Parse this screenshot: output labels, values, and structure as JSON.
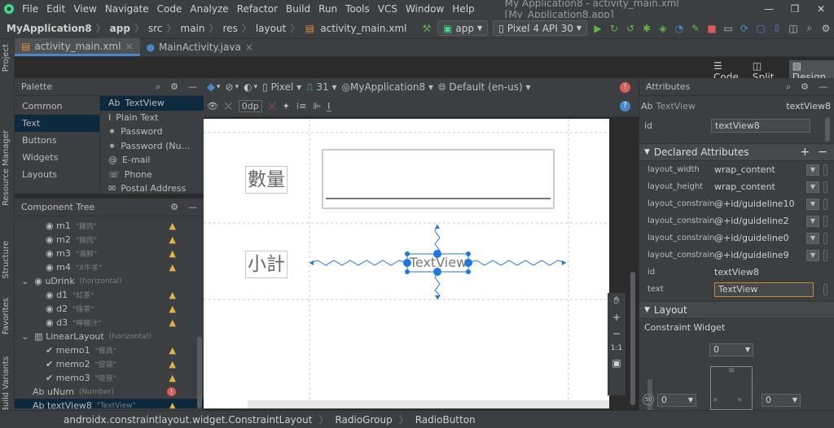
{
  "window": {
    "title": "My Application8 - activity_main.xml [My_Application8.app]"
  },
  "menu": [
    "File",
    "Edit",
    "View",
    "Navigate",
    "Code",
    "Analyze",
    "Refactor",
    "Build",
    "Run",
    "Tools",
    "VCS",
    "Window",
    "Help"
  ],
  "breadcrumb": [
    "MyApplication8",
    "app",
    "src",
    "main",
    "res",
    "layout",
    "activity_main.xml"
  ],
  "run": {
    "config": "app",
    "device": "Pixel 4 API 30"
  },
  "tabs": [
    "activity_main.xml",
    "MainActivity.java"
  ],
  "views": {
    "code": "Code",
    "split": "Split",
    "design": "Design"
  },
  "side_labels": {
    "project": "Project",
    "resource_manager": "Resource Manager",
    "structure": "Structure",
    "favorites": "Favorites",
    "build_variants": "Build Variants"
  },
  "palette": {
    "title": "Palette",
    "categories": [
      "Common",
      "Text",
      "Buttons",
      "Widgets",
      "Layouts"
    ],
    "items": [
      "TextView",
      "Plain Text",
      "Password",
      "Password (Nu...",
      "E-mail",
      "Phone",
      "Postal Address"
    ],
    "item_icon": "Ab"
  },
  "design_toolbar": {
    "device": "Pixel",
    "api": "31",
    "theme": "MyApplication8",
    "locale": "Default (en-us)",
    "margin": "0dp"
  },
  "tree": {
    "title": "Component Tree",
    "rows": [
      {
        "name": "m1",
        "hint": "\"雞肉\""
      },
      {
        "name": "m2",
        "hint": "\"豬肉\""
      },
      {
        "name": "m3",
        "hint": "\"海鮮\""
      },
      {
        "name": "m4",
        "hint": "\"X牛羊\""
      },
      {
        "name": "uDrink",
        "hint": "(horizontal)"
      },
      {
        "name": "d1",
        "hint": "\"紅茶\""
      },
      {
        "name": "d2",
        "hint": "\"綠茶\""
      },
      {
        "name": "d3",
        "hint": "\"檸檬汁\""
      },
      {
        "name": "LinearLayout",
        "hint": "(horizontal)"
      },
      {
        "name": "memo1",
        "hint": "\"餐具\""
      },
      {
        "name": "memo2",
        "hint": "\"提袋\""
      },
      {
        "name": "memo3",
        "hint": "\"吸管\""
      },
      {
        "name": "uNum",
        "hint": "(Number)"
      },
      {
        "name": "textView8",
        "hint": "\"TextView\""
      }
    ]
  },
  "canvas": {
    "label_qty": "數量",
    "label_subtotal": "小計",
    "textview": "TextView"
  },
  "attributes": {
    "title": "Attributes",
    "widget_icon": "Ab",
    "widget_type": "TextView",
    "widget_id": "textView8",
    "id_label": "id",
    "id_value": "textView8",
    "declared_title": "Declared Attributes",
    "rows": [
      {
        "k": "layout_width",
        "v": "wrap_content"
      },
      {
        "k": "layout_height",
        "v": "wrap_content"
      },
      {
        "k": "layout_constrain...",
        "v": "@+id/guideline10"
      },
      {
        "k": "layout_constrain...",
        "v": "@+id/guideline2"
      },
      {
        "k": "layout_constrain...",
        "v": "@+id/guideline0"
      },
      {
        "k": "layout_constrain...",
        "v": "@+id/guideline9"
      },
      {
        "k": "id",
        "v": "textView8"
      },
      {
        "k": "text",
        "v": "TextView"
      }
    ],
    "layout_title": "Layout",
    "constraint_widget": "Constraint Widget",
    "cw_top": "0",
    "cw_left": "0",
    "cw_right": "0"
  },
  "status": [
    "androidx.constraintlayout.widget.ConstraintLayout",
    "RadioGroup",
    "RadioButton"
  ],
  "colors": {
    "selection": "#0d293e",
    "accent": "#1e78e4",
    "warning": "#e3b341",
    "error": "#db5c5c"
  }
}
